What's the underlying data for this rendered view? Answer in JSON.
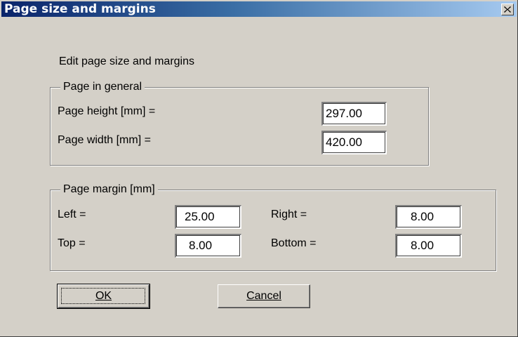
{
  "window": {
    "title": "Page size and margins",
    "close_glyph": "✕"
  },
  "heading": "Edit page size and margins",
  "general": {
    "legend": "Page in general",
    "height_label": "Page height [mm] =",
    "height_value": "297.00",
    "width_label": "Page width [mm] =",
    "width_value": "420.00"
  },
  "margin": {
    "legend": "Page margin [mm]",
    "left_label": "Left =",
    "left_value": "25.00",
    "top_label": "Top =",
    "top_value": "8.00",
    "right_label": "Right =",
    "right_value": "8.00",
    "bottom_label": "Bottom =",
    "bottom_value": "8.00"
  },
  "buttons": {
    "ok_label": "OK",
    "cancel_label": "Cancel"
  },
  "colors": {
    "face": "#d4d0c8",
    "title_active": "#0a246a",
    "title_gradient_end": "#a6caf0"
  }
}
